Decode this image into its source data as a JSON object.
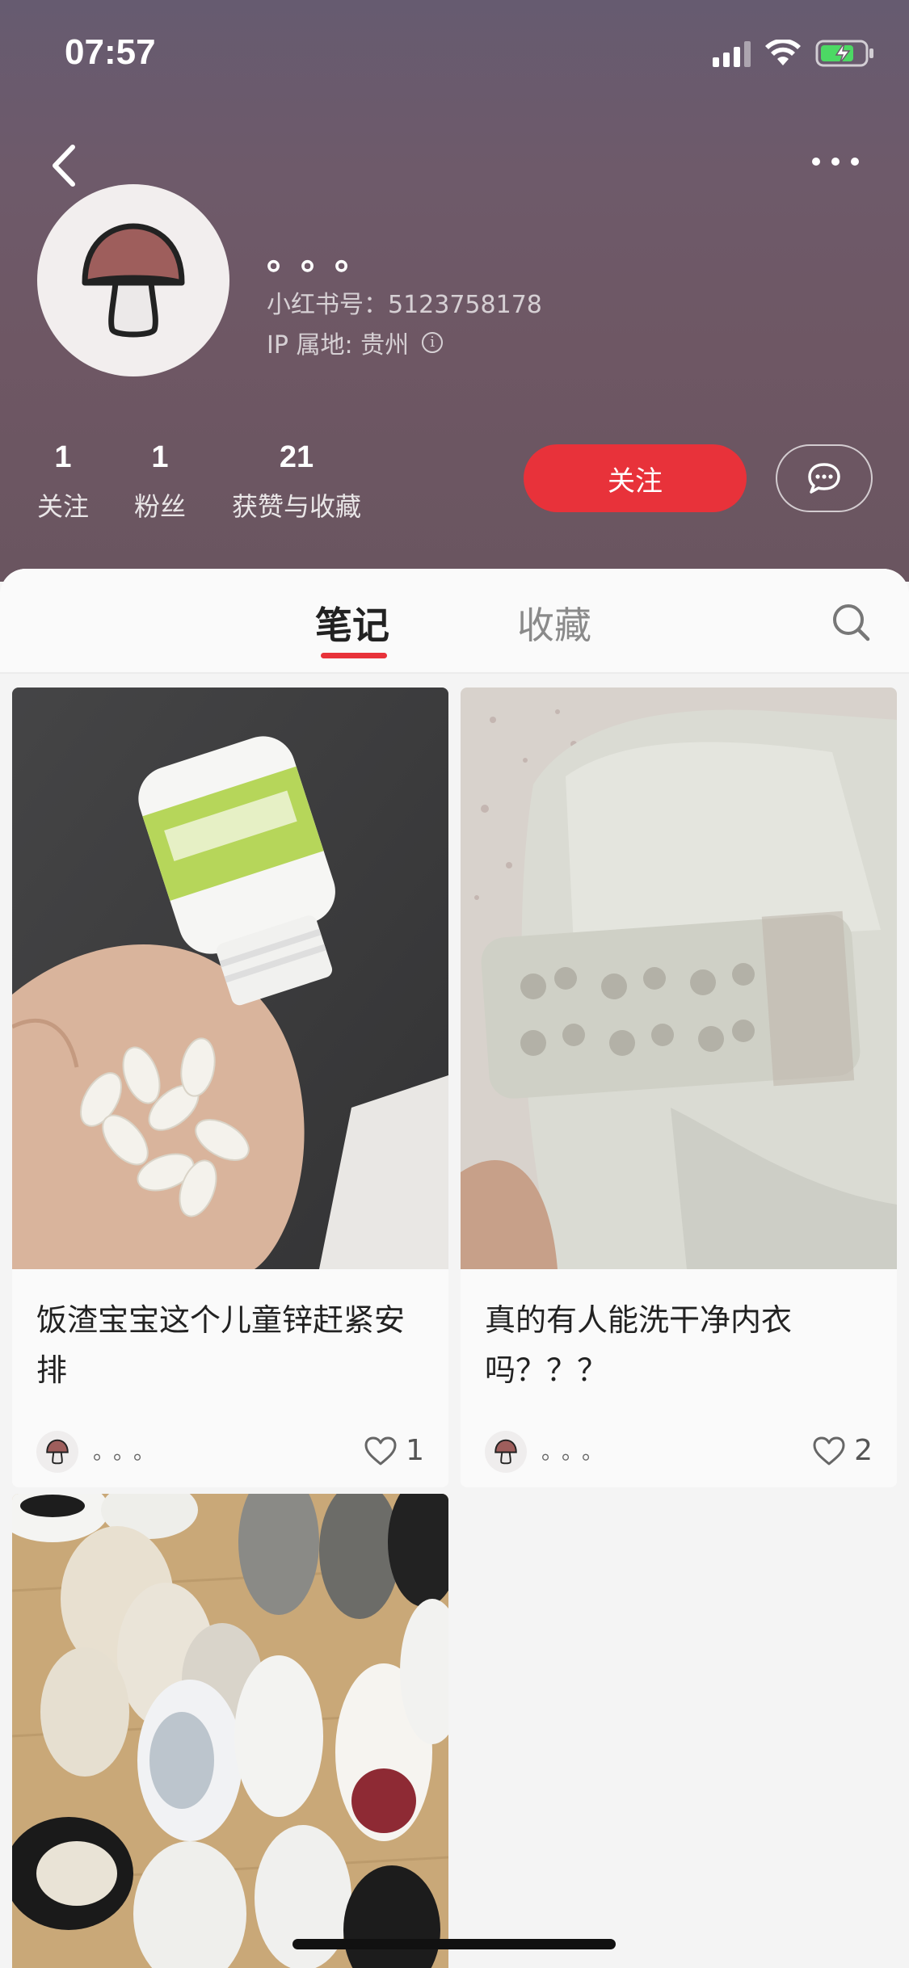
{
  "status_bar": {
    "time": "07:57"
  },
  "profile": {
    "nickname": "。。。",
    "redbook_id": "小红书号：5123758178",
    "ip_location": "IP 属地: 贵州",
    "stats": [
      {
        "value": "1",
        "label": "关注"
      },
      {
        "value": "1",
        "label": "粉丝"
      },
      {
        "value": "21",
        "label": "获赞与收藏"
      }
    ],
    "follow_label": "关注",
    "colors": {
      "accent": "#e8323a",
      "header_bg": "#6c586a"
    }
  },
  "tabs": {
    "notes": "笔记",
    "collections": "收藏",
    "active": "笔记"
  },
  "notes": [
    {
      "title": "饭渣宝宝这个儿童锌赶紧安排",
      "author": "。。。",
      "likes": "1",
      "image": "pills-bottle-photo"
    },
    {
      "title": "真的有人能洗干净内衣吗？？？",
      "author": "。。。",
      "likes": "2",
      "image": "underwear-closeup-photo"
    },
    {
      "title": "",
      "author": "",
      "likes": "",
      "image": "sneakers-floor-photo"
    }
  ],
  "icons": {
    "back": "chevron-left-icon",
    "more": "more-dots-icon",
    "chat": "chat-bubble-icon",
    "search": "search-icon",
    "like": "heart-outline-icon"
  }
}
